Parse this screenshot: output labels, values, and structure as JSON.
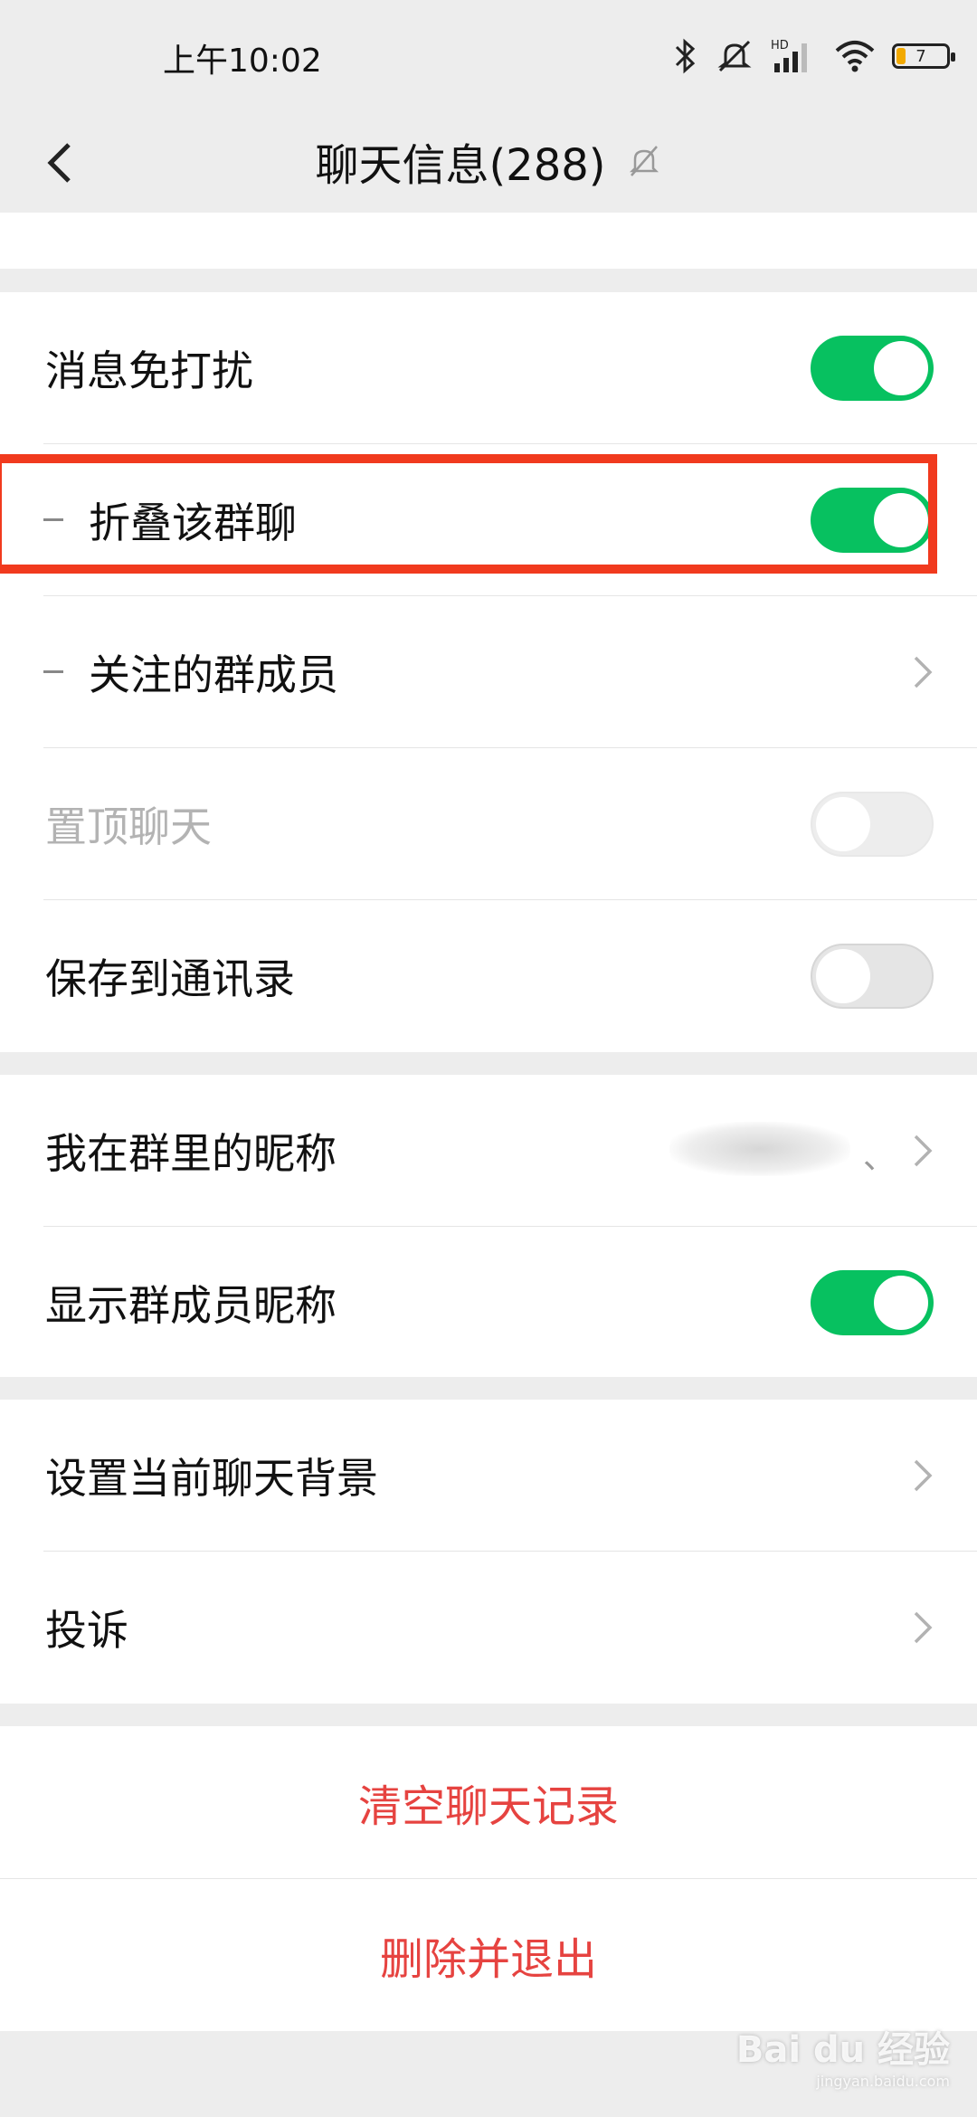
{
  "status_bar": {
    "time": "上午10:02",
    "battery_level": "7"
  },
  "header": {
    "title": "聊天信息(288)"
  },
  "settings": {
    "mute": {
      "label": "消息免打扰",
      "on": true
    },
    "fold_group": {
      "label": "折叠该群聊",
      "on": true
    },
    "followed_members": {
      "label": "关注的群成员"
    },
    "pin_chat": {
      "label": "置顶聊天",
      "on": false,
      "disabled": true
    },
    "save_contacts": {
      "label": "保存到通讯录",
      "on": false
    },
    "my_nickname": {
      "label": "我在群里的昵称",
      "value_suffix": "、"
    },
    "show_nicknames": {
      "label": "显示群成员昵称",
      "on": true
    },
    "chat_background": {
      "label": "设置当前聊天背景"
    },
    "complain": {
      "label": "投诉"
    }
  },
  "actions": {
    "clear_history": "清空聊天记录",
    "delete_exit": "删除并退出"
  },
  "watermark": {
    "brand": "Bai du 经验",
    "url": "jingyan.baidu.com"
  },
  "colors": {
    "toggle_on": "#07c160",
    "danger": "#e64340",
    "highlight": "#f13a1e"
  }
}
